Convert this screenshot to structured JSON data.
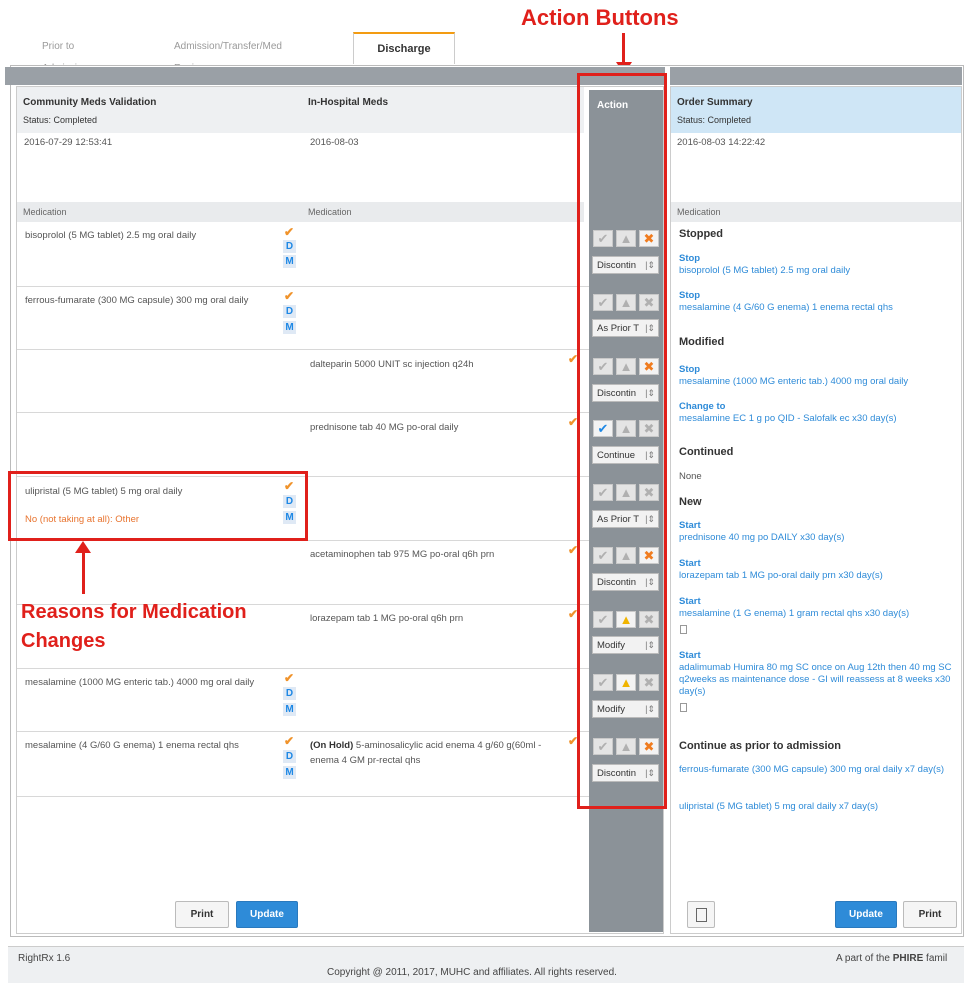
{
  "tabs": [
    "Prior to Admission",
    "Admission/Transfer/Med Review",
    "Discharge"
  ],
  "annotations": {
    "action_buttons": "Action Buttons",
    "reasons": "Reasons for Medication Changes"
  },
  "community": {
    "title": "Community Meds Validation",
    "status": "Status: Completed",
    "date": "2016-07-29 12:53:41",
    "med_header": "Medication"
  },
  "inhospital": {
    "title": "In-Hospital Meds",
    "date": "2016-08-03",
    "med_header": "Medication"
  },
  "action": {
    "title": "Action"
  },
  "summary": {
    "title": "Order Summary",
    "status": "Status: Completed",
    "date": "2016-08-03 14:22:42",
    "med_header": "Medication"
  },
  "rows": [
    {
      "community": "bisoprolol (5 MG tablet) 2.5 mg oral daily",
      "inhospital": "",
      "select": "Discontin"
    },
    {
      "community": "ferrous-fumarate (300 MG capsule) 300 mg oral daily",
      "inhospital": "",
      "select": "As Prior T"
    },
    {
      "community": "",
      "inhospital": "dalteparin 5000 UNIT sc injection q24h",
      "select": "Discontin"
    },
    {
      "community": "",
      "inhospital": "prednisone tab 40 MG po-oral daily",
      "select": "Continue"
    },
    {
      "community": "ulipristal (5 MG tablet) 5 mg oral daily",
      "reason": "No (not taking at all): Other",
      "inhospital": "",
      "select": "As Prior T"
    },
    {
      "community": "",
      "inhospital": "acetaminophen tab 975 MG po-oral q6h prn",
      "select": "Discontin"
    },
    {
      "community": "",
      "inhospital": "lorazepam tab 1 MG po-oral q6h prn",
      "select": "Modify"
    },
    {
      "community": "mesalamine (1000 MG enteric tab.) 4000 mg oral daily",
      "inhospital": "",
      "select": "Modify"
    },
    {
      "community": "mesalamine (4 G/60 G enema) 1 enema rectal qhs",
      "inhospital_bold": "(On Hold)",
      "inhospital": "5-aminosalicylic acid enema 4 g/60 g(60ml - enema 4 GM pr-rectal qhs",
      "select": "Discontin"
    }
  ],
  "letters": {
    "d": "D",
    "m": "M"
  },
  "right": {
    "stopped": "Stopped",
    "stop1_k": "Stop",
    "stop1": "bisoprolol (5 MG tablet) 2.5 mg oral daily",
    "stop2_k": "Stop",
    "stop2": "mesalamine (4 G/60 G enema) 1 enema rectal qhs",
    "modified": "Modified",
    "stop3_k": "Stop",
    "stop3": "mesalamine (1000 MG enteric tab.) 4000 mg oral daily",
    "change_k": "Change to",
    "change": "mesalamine EC 1 g po QID - Salofalk ec x30 day(s)",
    "continued": "Continued",
    "none": "None",
    "new": "New",
    "start1_k": "Start",
    "start1": "prednisone 40 mg po DAILY x30 day(s)",
    "start2_k": "Start",
    "start2": "lorazepam tab 1 MG po-oral daily prn x30 day(s)",
    "start3_k": "Start",
    "start3": "mesalamine (1 G enema) 1 gram rectal qhs x30 day(s)",
    "start4_k": "Start",
    "start4": "adalimumab Humira 80 mg SC once on Aug 12th then 40 mg SC q2weeks as maintenance dose - GI will reassess at 8 weeks x30 day(s)",
    "cont_prior": "Continue as prior to admission",
    "cp1": "ferrous-fumarate (300 MG capsule) 300 mg oral daily x7 day(s)",
    "cp2": "ulipristal (5 MG tablet) 5 mg oral daily x7 day(s)"
  },
  "buttons": {
    "print": "Print",
    "update": "Update"
  },
  "footer": {
    "version": "RightRx 1.6",
    "copyright": "Copyright @ 2011, 2017, MUHC and affiliates. All rights reserved.",
    "phire_prefix": "A part of the ",
    "phire_bold": "PHIRE",
    "phire_suffix": " famil"
  }
}
